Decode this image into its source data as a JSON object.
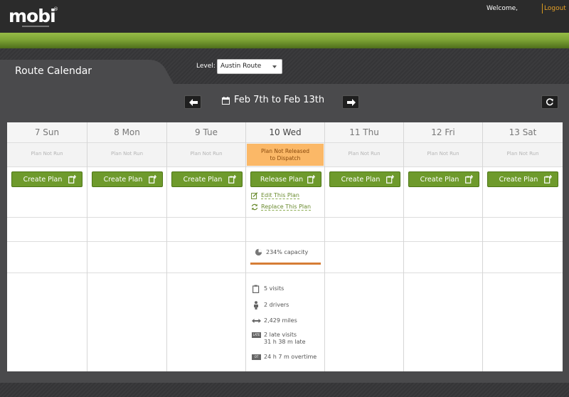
{
  "header": {
    "logo": "mobi",
    "logo_mark": "®",
    "welcome": "Welcome,",
    "logout": "Logout"
  },
  "page": {
    "title": "Route Calendar",
    "level_label": "Level:",
    "level_value": "Austin Route",
    "date_range": "Feb 7th to Feb 13th"
  },
  "days": [
    {
      "label": "7 Sun",
      "status": "Plan Not Run",
      "button": "Create Plan"
    },
    {
      "label": "8 Mon",
      "status": "Plan Not Run",
      "button": "Create Plan"
    },
    {
      "label": "9 Tue",
      "status": "Plan Not Run",
      "button": "Create Plan"
    },
    {
      "label": "10 Wed",
      "status_line1": "Plan Not Released",
      "status_line2": "to Dispatch",
      "button": "Release Plan",
      "links": {
        "edit": "Edit This Plan",
        "replace": "Replace This Plan"
      },
      "capacity": "234% capacity",
      "stats": {
        "visits": "5 visits",
        "drivers": "2 drivers",
        "miles": "2,429 miles",
        "late_line1": "2 late visits",
        "late_line2": "31 h 38 m late",
        "overtime": "24 h 7 m overtime",
        "late_badge": "LATE",
        "ot_badge": "OT"
      }
    },
    {
      "label": "11 Thu",
      "status": "Plan Not Run",
      "button": "Create Plan"
    },
    {
      "label": "12 Fri",
      "status": "Plan Not Run",
      "button": "Create Plan"
    },
    {
      "label": "13 Sat",
      "status": "Plan Not Run",
      "button": "Create Plan"
    }
  ],
  "colors": {
    "accent_green": "#6e9a2c",
    "warning_orange": "#fbb867",
    "capacity_bar": "#d67d36",
    "logout": "#e6a127"
  }
}
